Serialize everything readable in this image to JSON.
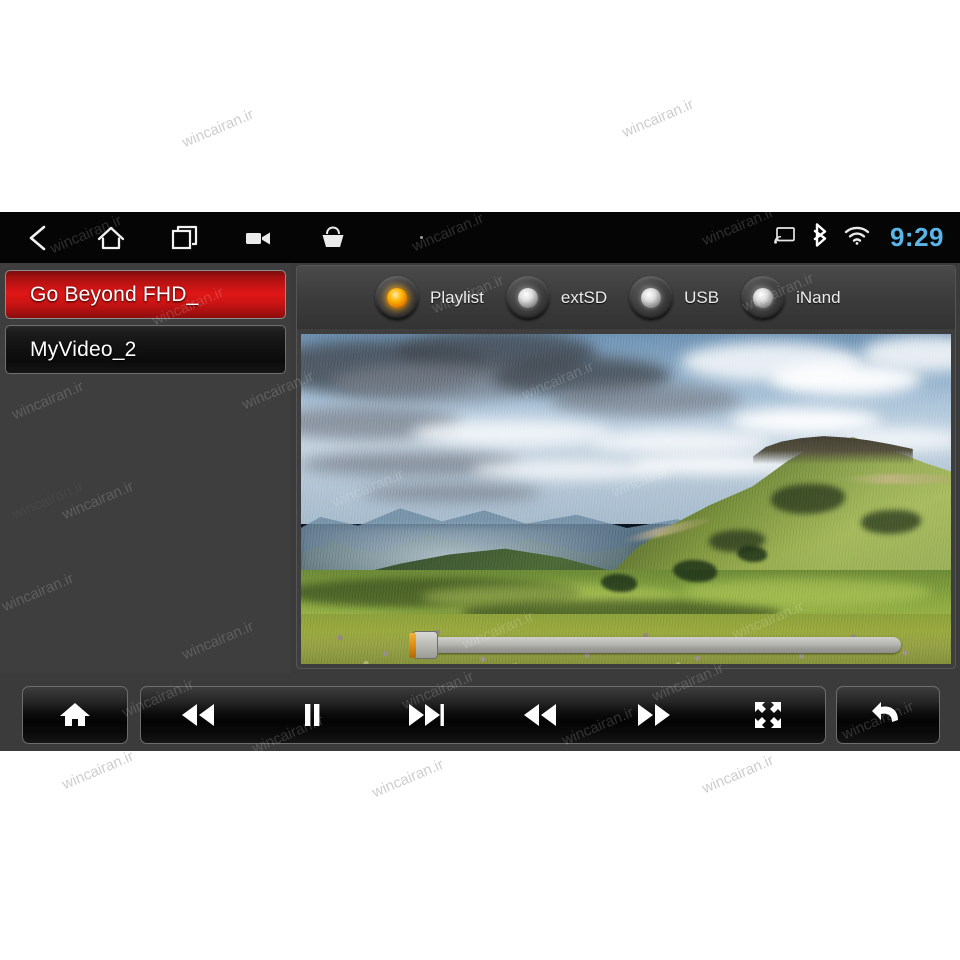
{
  "statusbar": {
    "nav": [
      {
        "name": "back",
        "icon": "chevron-left-icon",
        "label": "Back"
      },
      {
        "name": "home",
        "icon": "home-icon",
        "label": "Home"
      },
      {
        "name": "recents",
        "icon": "recent-apps-icon",
        "label": "Recent apps"
      },
      {
        "name": "camera",
        "icon": "video-camera-icon",
        "label": "Camera"
      },
      {
        "name": "basket",
        "icon": "shopping-basket-icon",
        "label": "Apps"
      }
    ],
    "more_label": "More options",
    "indicators": [
      {
        "name": "cast",
        "icon": "cast-screen-icon",
        "label": "Cast"
      },
      {
        "name": "bluetooth",
        "icon": "bluetooth-icon",
        "label": "Bluetooth"
      },
      {
        "name": "wifi",
        "icon": "wifi-icon",
        "label": "Wi-Fi"
      }
    ],
    "clock": "9:29",
    "clock_color": "#5ab6e8"
  },
  "playlist": {
    "items": [
      {
        "label": "Go Beyond FHD_",
        "selected": true
      },
      {
        "label": "MyVideo_2",
        "selected": false
      }
    ],
    "selected_color": "#e01616"
  },
  "sources": {
    "items": [
      {
        "label": "Playlist",
        "active": true
      },
      {
        "label": "extSD",
        "active": false
      },
      {
        "label": "USB",
        "active": false
      },
      {
        "label": "iNand",
        "active": false
      }
    ],
    "active_led_color": "#ffb400",
    "inactive_led_color": "#dcdcdc"
  },
  "video": {
    "title": "Go Beyond FHD_",
    "scene_description": "Mountain meadow landscape with dramatic cloudy sky",
    "progress_percent": 0,
    "seek_handle_color": "#e08c10",
    "seek_track_color": "#b9b9b4"
  },
  "controls": {
    "home": {
      "label": "Home",
      "icon": "home-icon"
    },
    "transport": [
      {
        "label": "Previous",
        "icon": "previous-track-icon"
      },
      {
        "label": "Pause",
        "icon": "pause-icon"
      },
      {
        "label": "Next",
        "icon": "next-track-icon"
      },
      {
        "label": "Rewind",
        "icon": "rewind-icon"
      },
      {
        "label": "Fast forward",
        "icon": "fast-forward-icon"
      },
      {
        "label": "Fullscreen",
        "icon": "fullscreen-expand-icon"
      }
    ],
    "back": {
      "label": "Back",
      "icon": "return-arrow-icon"
    }
  },
  "watermark": {
    "text": "wincairan.ir"
  }
}
